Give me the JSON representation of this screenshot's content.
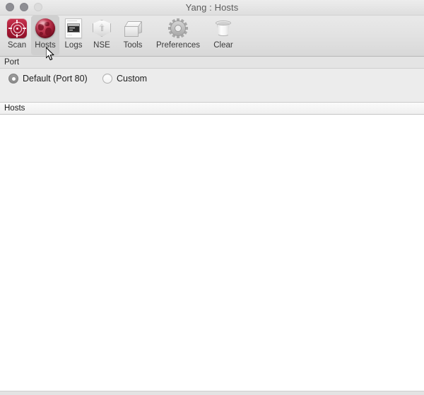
{
  "window": {
    "title": "Yang : Hosts",
    "controls": {
      "close": "close-button",
      "minimize": "minimize-button",
      "zoom": "zoom-button"
    }
  },
  "toolbar": {
    "items": [
      {
        "label": "Scan",
        "icon": "target-icon",
        "selected": false
      },
      {
        "label": "Hosts",
        "icon": "globe-icon",
        "selected": true
      },
      {
        "label": "Logs",
        "icon": "terminal-doc-icon",
        "selected": false
      },
      {
        "label": "NSE",
        "icon": "shield-cube-icon",
        "selected": false
      },
      {
        "label": "Tools",
        "icon": "box-icon",
        "selected": false
      },
      {
        "label": "Preferences",
        "icon": "gear-icon",
        "selected": false
      },
      {
        "label": "Clear",
        "icon": "trash-icon",
        "selected": false
      }
    ]
  },
  "port_section": {
    "header": "Port",
    "radio_default": {
      "label": "Default (Port 80)",
      "selected": true
    },
    "radio_custom": {
      "label": "Custom",
      "selected": false
    },
    "field_one": {
      "value": "",
      "placeholder": ""
    },
    "field_two": {
      "value": "",
      "placeholder": ""
    }
  },
  "hosts_section": {
    "column_header": "Hosts",
    "rows": []
  },
  "colors": {
    "accent_red": "#a81a36",
    "toolbar_selected": "#cfcfcf",
    "window_chrome": "#e9e9e9",
    "text_primary": "#202020"
  }
}
